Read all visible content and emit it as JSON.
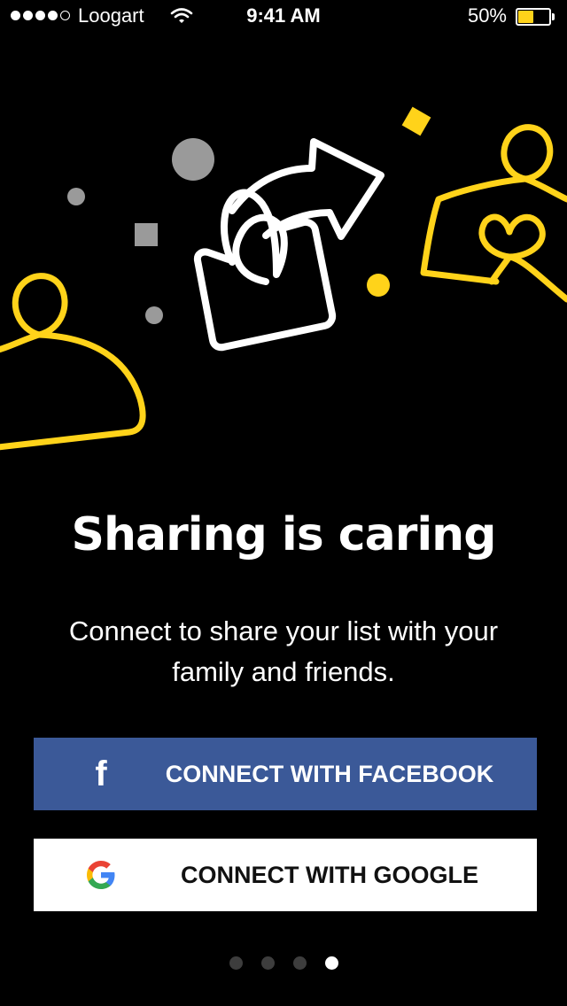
{
  "status_bar": {
    "carrier": "Loogart",
    "time": "9:41 AM",
    "battery_percent": "50%",
    "battery_level": 0.5,
    "signal_bars_filled": 4,
    "signal_bars_total": 5
  },
  "onboarding": {
    "title": "Sharing is caring",
    "subtitle": "Connect to share your list with your family and friends.",
    "facebook_button": {
      "label": "CONNECT WITH FACEBOOK",
      "icon": "facebook-f-icon",
      "color": "#3b5998"
    },
    "google_button": {
      "label": "CONNECT WITH GOOGLE",
      "icon": "google-g-icon",
      "color": "#ffffff"
    },
    "pager": {
      "total": 4,
      "current": 4
    }
  },
  "colors": {
    "background": "#000000",
    "accent_yellow": "#ffd31a",
    "shape_gray": "#9a9a9a"
  }
}
